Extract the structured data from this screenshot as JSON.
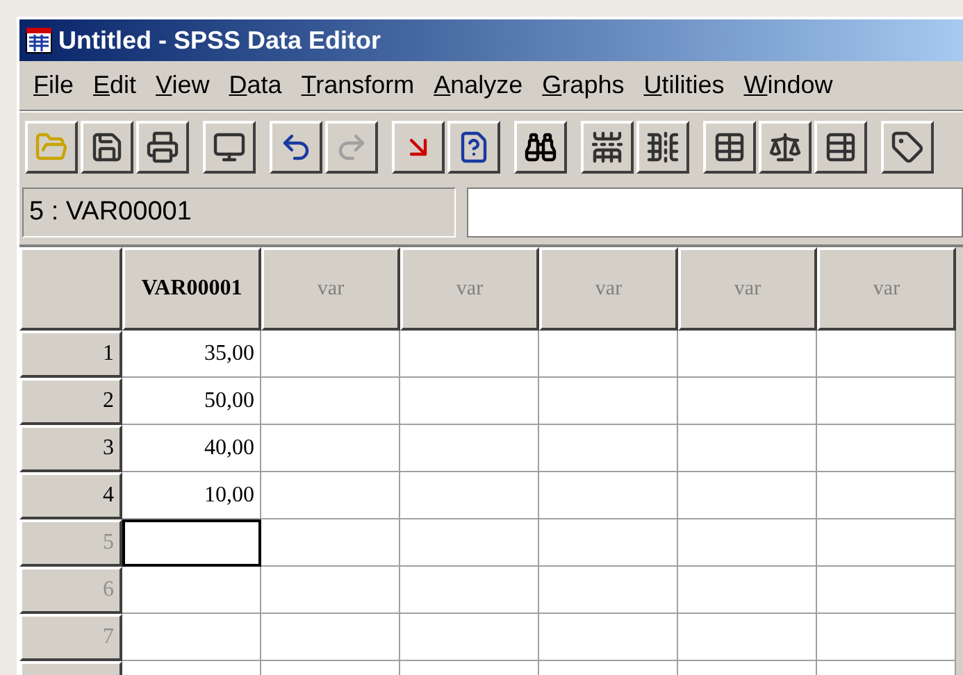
{
  "window": {
    "title": "Untitled - SPSS Data Editor"
  },
  "menu": [
    "File",
    "Edit",
    "View",
    "Data",
    "Transform",
    "Analyze",
    "Graphs",
    "Utilities",
    "Window"
  ],
  "toolbar": [
    [
      {
        "kind": "open",
        "disabled": false
      },
      {
        "kind": "save",
        "disabled": false
      },
      {
        "kind": "print",
        "disabled": false
      }
    ],
    [
      {
        "kind": "recall",
        "disabled": false
      }
    ],
    [
      {
        "kind": "undo",
        "disabled": false
      },
      {
        "kind": "redo",
        "disabled": true
      }
    ],
    [
      {
        "kind": "goto",
        "disabled": false
      },
      {
        "kind": "variables",
        "disabled": false
      }
    ],
    [
      {
        "kind": "find",
        "disabled": false
      }
    ],
    [
      {
        "kind": "insert_case",
        "disabled": false
      },
      {
        "kind": "insert_variable",
        "disabled": false
      }
    ],
    [
      {
        "kind": "split",
        "disabled": false
      },
      {
        "kind": "weight",
        "disabled": false
      },
      {
        "kind": "select",
        "disabled": false
      }
    ],
    [
      {
        "kind": "labels",
        "disabled": false
      }
    ]
  ],
  "cell_reference": "5 : VAR00001",
  "table": {
    "columns": [
      {
        "label": "VAR00001",
        "defined": true
      },
      {
        "label": "var",
        "defined": false
      },
      {
        "label": "var",
        "defined": false
      },
      {
        "label": "var",
        "defined": false
      },
      {
        "label": "var",
        "defined": false
      },
      {
        "label": "var",
        "defined": false
      }
    ],
    "rows": [
      {
        "label": "1",
        "defined": true,
        "cells": [
          {
            "value": "35,00",
            "selected": false
          }
        ]
      },
      {
        "label": "2",
        "defined": true,
        "cells": [
          {
            "value": "50,00",
            "selected": false
          }
        ]
      },
      {
        "label": "3",
        "defined": true,
        "cells": [
          {
            "value": "40,00",
            "selected": false
          }
        ]
      },
      {
        "label": "4",
        "defined": true,
        "cells": [
          {
            "value": "10,00",
            "selected": false
          }
        ]
      },
      {
        "label": "5",
        "defined": false,
        "cells": [
          {
            "selected": true
          }
        ]
      },
      {
        "label": "6",
        "defined": false,
        "cells": [
          {
            "selected": false
          }
        ]
      },
      {
        "label": "7",
        "defined": false,
        "cells": [
          {
            "selected": false
          }
        ]
      }
    ]
  }
}
